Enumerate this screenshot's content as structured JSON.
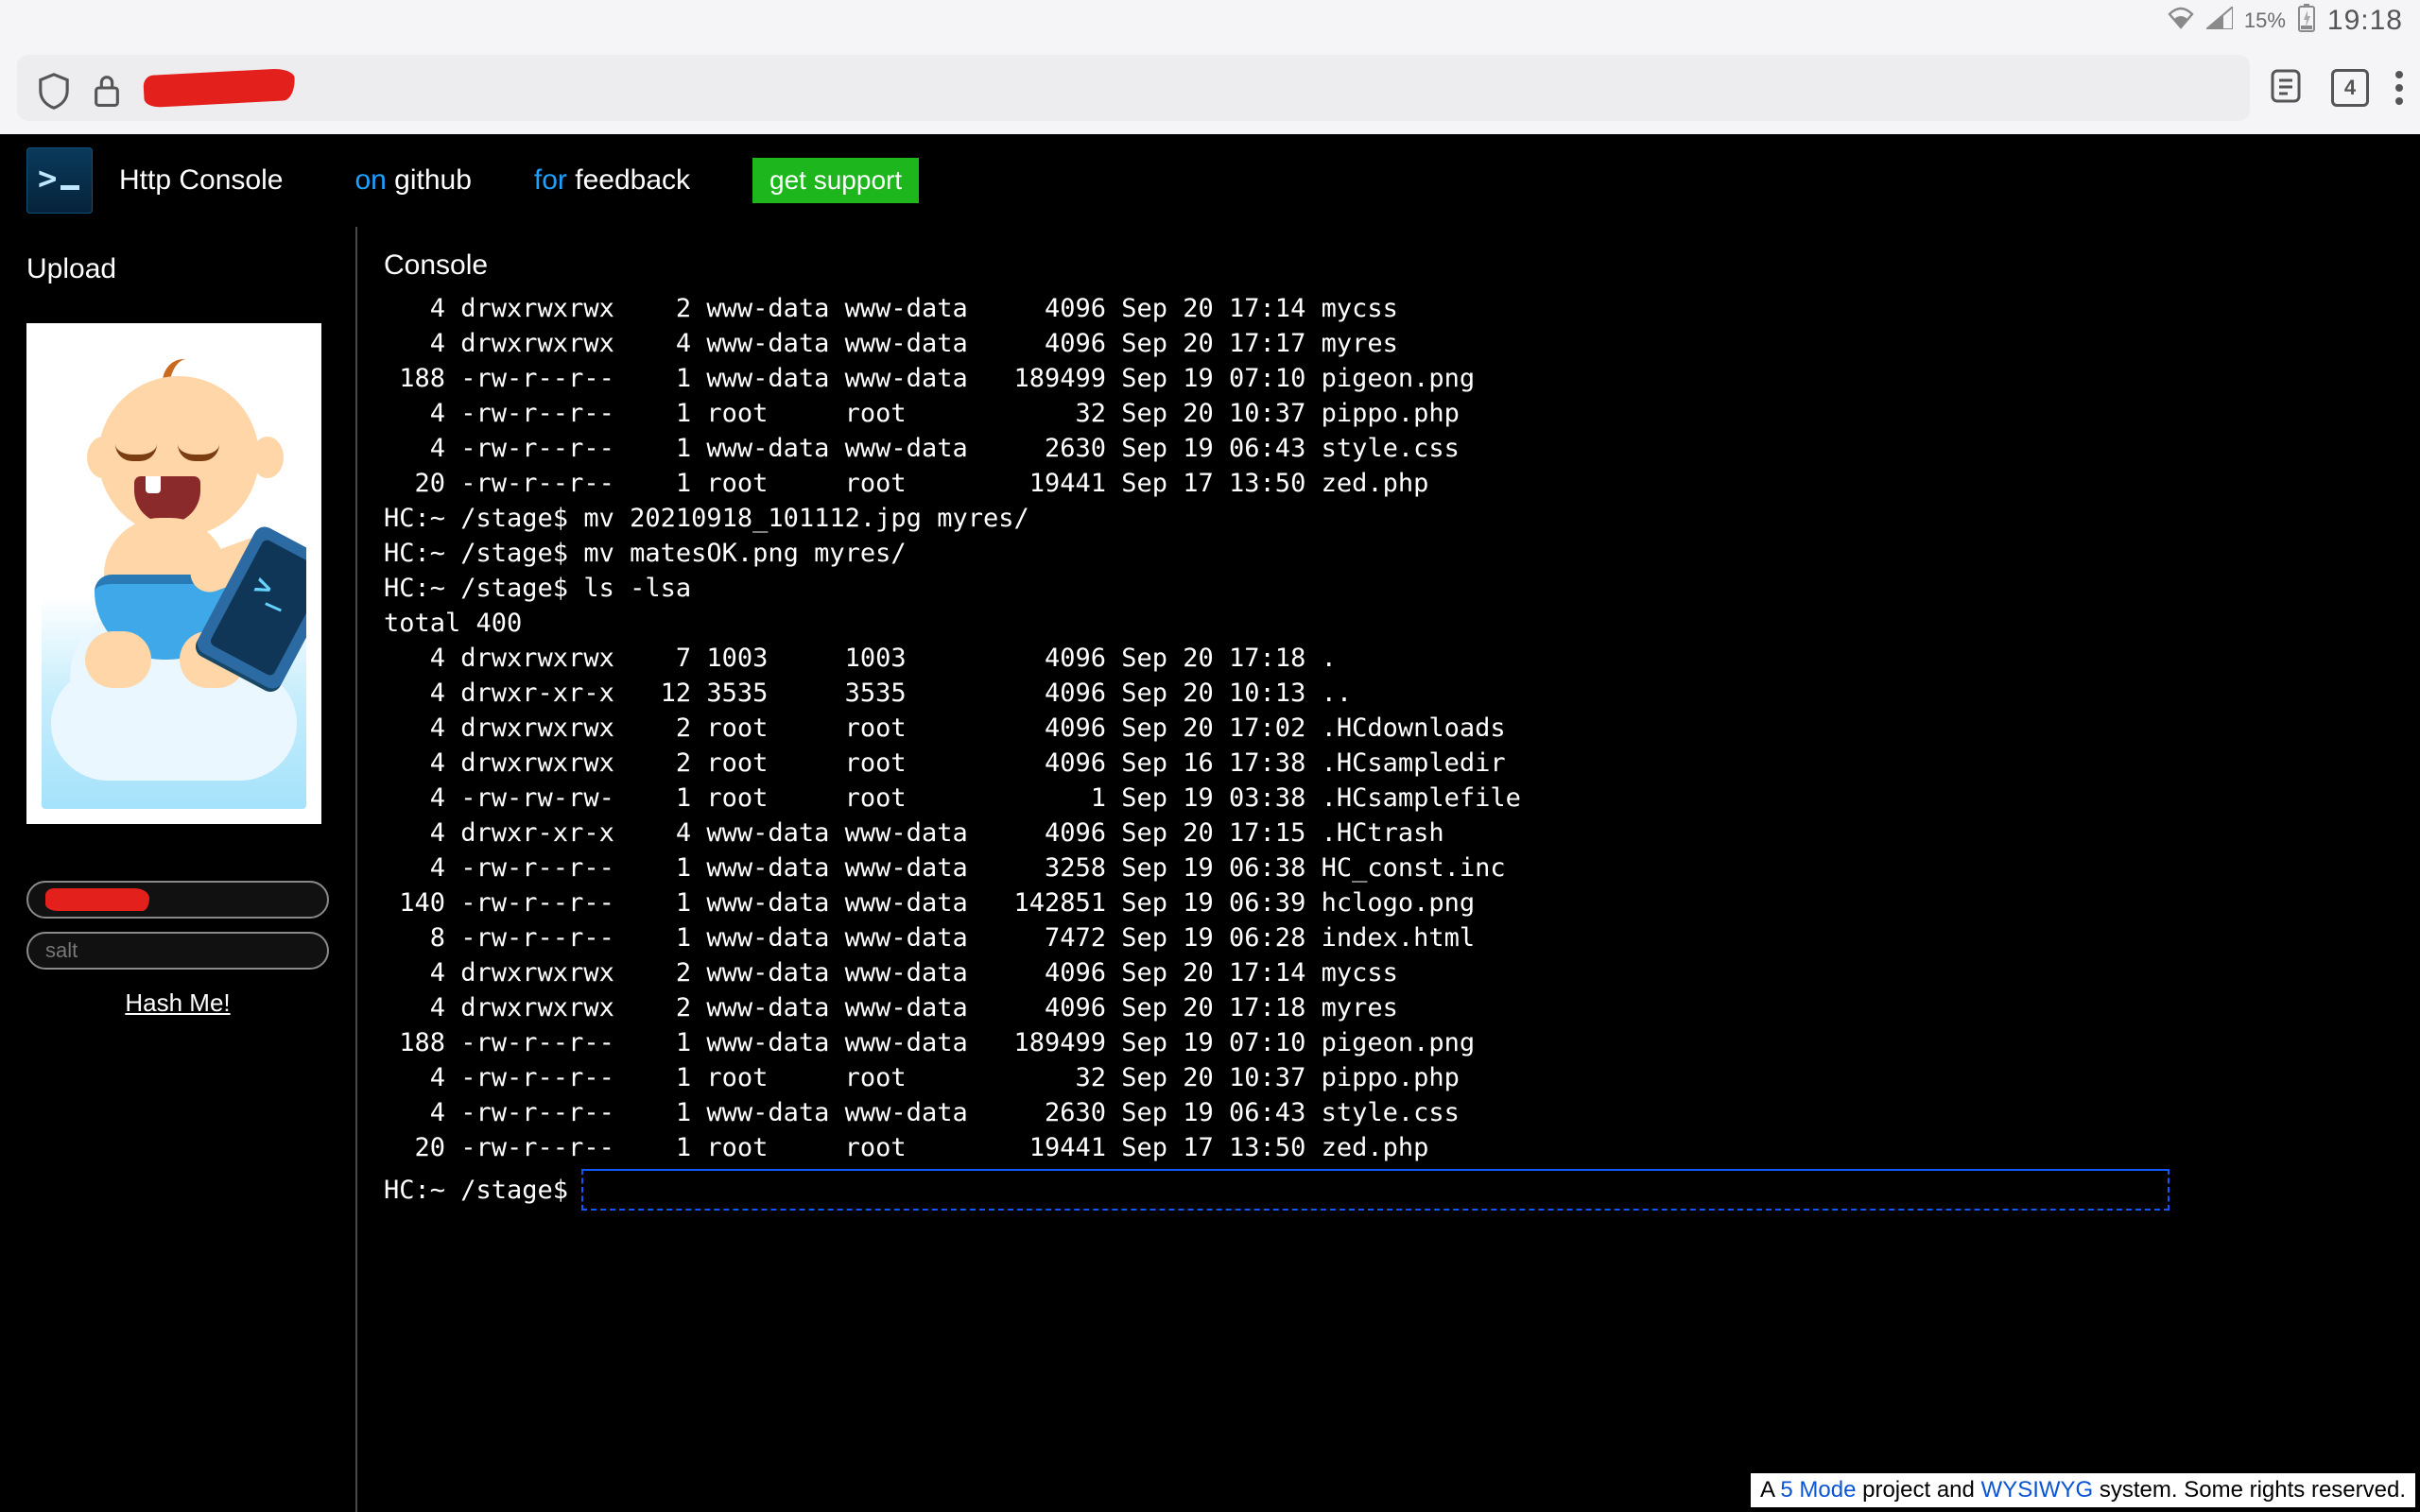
{
  "status_bar": {
    "battery_pct": "15%",
    "clock": "19:18"
  },
  "browser": {
    "tab_count": "4"
  },
  "header": {
    "title": "Http Console",
    "github_prefix": "on ",
    "github_word": "github",
    "feedback_prefix": "for ",
    "feedback_word": "feedback",
    "support_label": "get support"
  },
  "sidebar": {
    "upload_heading": "Upload",
    "salt_placeholder": "salt",
    "hash_label": "Hash Me!"
  },
  "console": {
    "heading": "Console",
    "prompt": "HC:~ /stage$",
    "output": "   4 drwxrwxrwx    2 www-data www-data     4096 Sep 20 17:14 mycss\n   4 drwxrwxrwx    4 www-data www-data     4096 Sep 20 17:17 myres\n 188 -rw-r--r--    1 www-data www-data   189499 Sep 19 07:10 pigeon.png\n   4 -rw-r--r--    1 root     root           32 Sep 20 10:37 pippo.php\n   4 -rw-r--r--    1 www-data www-data     2630 Sep 19 06:43 style.css\n  20 -rw-r--r--    1 root     root        19441 Sep 17 13:50 zed.php\nHC:~ /stage$ mv 20210918_101112.jpg myres/\nHC:~ /stage$ mv matesOK.png myres/\nHC:~ /stage$ ls -lsa\ntotal 400\n   4 drwxrwxrwx    7 1003     1003         4096 Sep 20 17:18 .\n   4 drwxr-xr-x   12 3535     3535         4096 Sep 20 10:13 ..\n   4 drwxrwxrwx    2 root     root         4096 Sep 20 17:02 .HCdownloads\n   4 drwxrwxrwx    2 root     root         4096 Sep 16 17:38 .HCsampledir\n   4 -rw-rw-rw-    1 root     root            1 Sep 19 03:38 .HCsamplefile\n   4 drwxr-xr-x    4 www-data www-data     4096 Sep 20 17:15 .HCtrash\n   4 -rw-r--r--    1 www-data www-data     3258 Sep 19 06:38 HC_const.inc\n 140 -rw-r--r--    1 www-data www-data   142851 Sep 19 06:39 hclogo.png\n   8 -rw-r--r--    1 www-data www-data     7472 Sep 19 06:28 index.html\n   4 drwxrwxrwx    2 www-data www-data     4096 Sep 20 17:14 mycss\n   4 drwxrwxrwx    2 www-data www-data     4096 Sep 20 17:18 myres\n 188 -rw-r--r--    1 www-data www-data   189499 Sep 19 07:10 pigeon.png\n   4 -rw-r--r--    1 root     root           32 Sep 20 10:37 pippo.php\n   4 -rw-r--r--    1 www-data www-data     2630 Sep 19 06:43 style.css\n  20 -rw-r--r--    1 root     root        19441 Sep 17 13:50 zed.php"
  },
  "footer": {
    "pre": "A ",
    "link1": "5 Mode",
    "mid": " project and ",
    "link2": "WYSIWYG",
    "post": " system. Some rights reserved."
  }
}
